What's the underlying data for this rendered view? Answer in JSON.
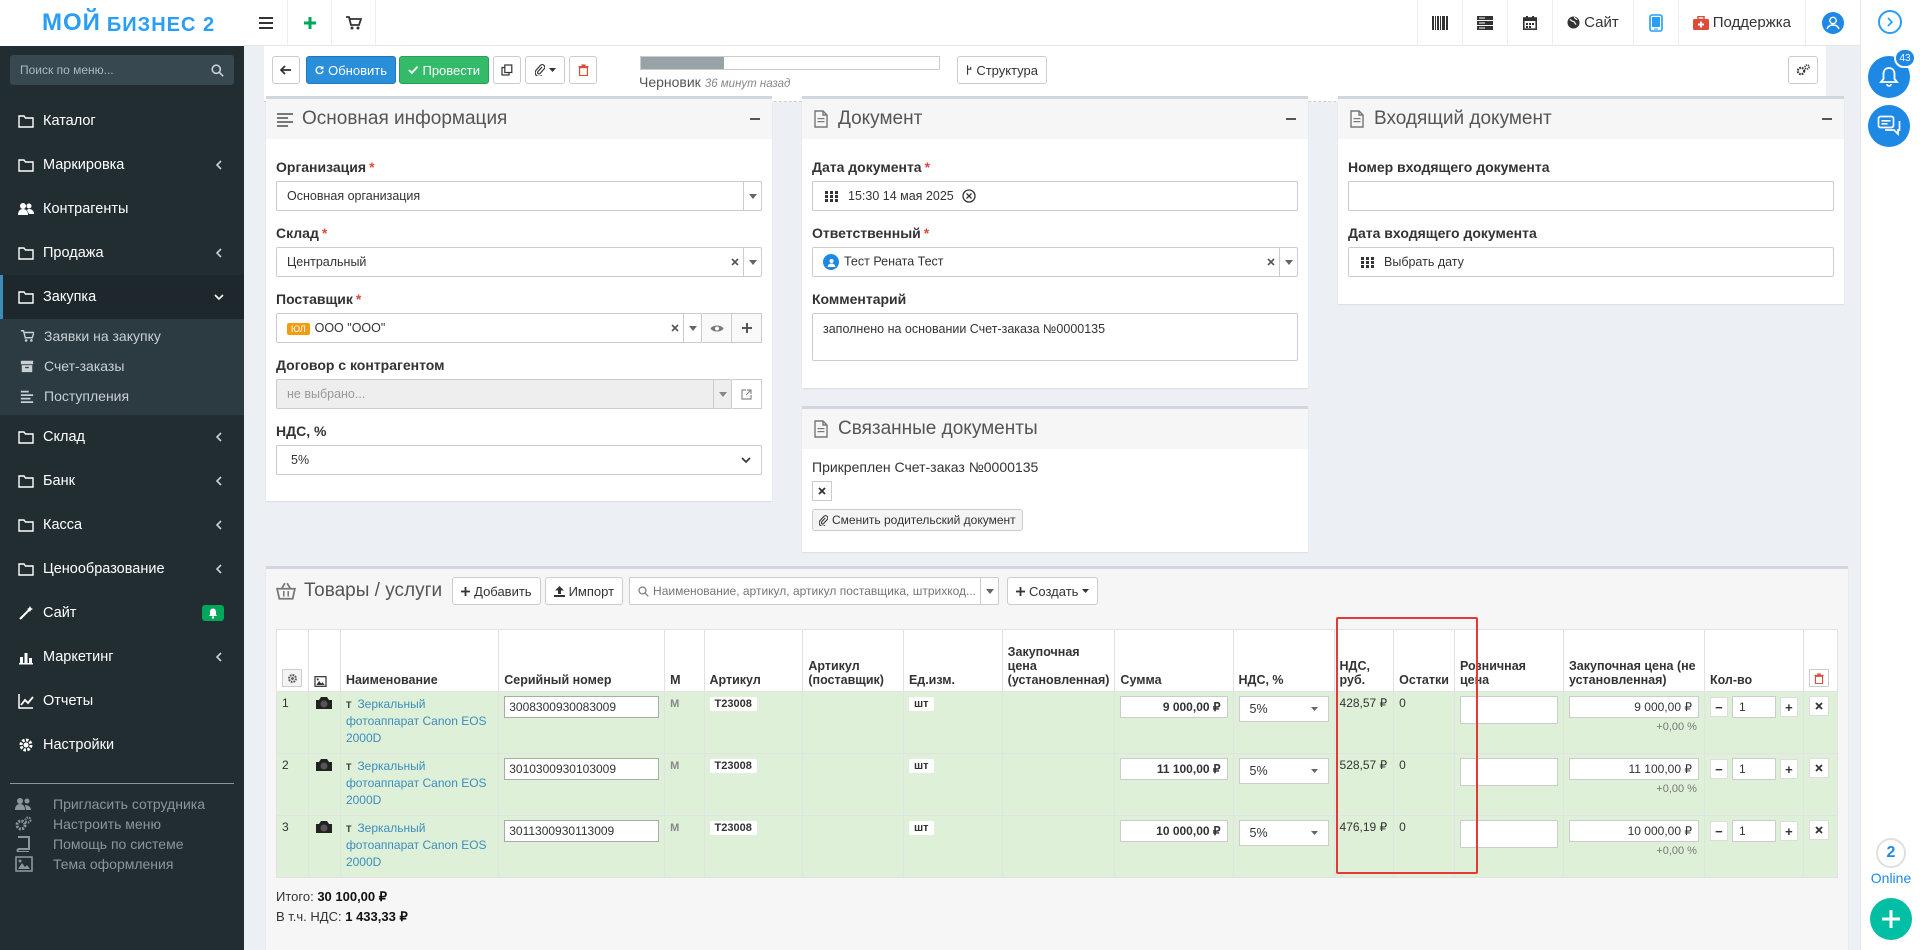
{
  "sidebar": {
    "logo_line1": "МОЙ",
    "logo_line2": "БИЗНЕС 2",
    "search_placeholder": "Поиск по меню...",
    "items": [
      {
        "label": "Каталог"
      },
      {
        "label": "Маркировка"
      },
      {
        "label": "Контрагенты"
      },
      {
        "label": "Продажа"
      },
      {
        "label": "Закупка"
      },
      {
        "label": "Склад"
      },
      {
        "label": "Банк"
      },
      {
        "label": "Касса"
      },
      {
        "label": "Ценообразование"
      },
      {
        "label": "Сайт"
      },
      {
        "label": "Маркетинг"
      },
      {
        "label": "Отчеты"
      },
      {
        "label": "Настройки"
      }
    ],
    "subitems": [
      {
        "label": "Заявки на закупку"
      },
      {
        "label": "Счет-заказы"
      },
      {
        "label": "Поступления"
      }
    ],
    "bottom": [
      {
        "label": "Пригласить сотрудника"
      },
      {
        "label": "Настроить меню"
      },
      {
        "label": "Помощь по системе"
      },
      {
        "label": "Тема оформления"
      }
    ]
  },
  "topnav": {
    "site_label": "Сайт",
    "support_label": "Поддержка"
  },
  "rail": {
    "notif_count": "43",
    "online_count": "2",
    "online_label": "Online"
  },
  "toolbar": {
    "refresh_label": "Обновить",
    "post_label": "Провести",
    "structure_label": "Структура",
    "status_label": "Черновик",
    "status_time": "36 минут назад",
    "progress": 0.28
  },
  "basic": {
    "title": "Основная информация",
    "org_label": "Организация",
    "org_value": "Основная организация",
    "warehouse_label": "Склад",
    "warehouse_value": "Центральный",
    "supplier_label": "Поставщик",
    "supplier_tag": "ЮЛ",
    "supplier_value": "ООО \"ООО\"",
    "contract_label": "Договор с контрагентом",
    "contract_value": "не выбрано...",
    "vat_label": "НДС, %",
    "vat_value": "5%"
  },
  "document": {
    "title": "Документ",
    "date_label": "Дата документа",
    "date_value": "15:30 14 мая 2025",
    "resp_label": "Ответственный",
    "resp_value": "Тест Рената Тест",
    "comment_label": "Комментарий",
    "comment_value": "заполнено на основании Счет-заказа №0000135"
  },
  "incoming": {
    "title": "Входящий документ",
    "number_label": "Номер входящего документа",
    "number_value": "",
    "date_label": "Дата входящего документа",
    "date_value": "Выбрать дату"
  },
  "linked": {
    "title": "Связанные документы",
    "attached": "Прикреплен Счет-заказ №0000135",
    "change_label": "Сменить родительский документ"
  },
  "goods": {
    "title": "Товары / услуги",
    "add_label": "Добавить",
    "import_label": "Импорт",
    "search_placeholder": "Наименование, артикул, артикул поставщика, штрихкод...",
    "create_label": "Создать",
    "columns": {
      "name": "Наименование",
      "serial": "Серийный номер",
      "m": "М",
      "article": "Артикул",
      "sup_article": "Артикул (поставщик)",
      "unit": "Ед.изм.",
      "price_set": "Закупочная цена (установленная)",
      "sum": "Сумма",
      "vat_pct": "НДС, %",
      "vat_rub": "НДС, руб.",
      "stock": "Остатки",
      "retail": "Розничная цена",
      "price_unset": "Закупочная цена (не установленная)",
      "qty": "Кол-во"
    },
    "rows": [
      {
        "n": "1",
        "type": "Т",
        "name": "Зеркальный фотоаппарат Canon EOS 2000D",
        "serial": "3008300930083009",
        "m": "М",
        "article": "Т23008",
        "unit": "шт",
        "sum": "9 000,00 ₽",
        "vat": "5%",
        "vat_rub": "428,57 ₽",
        "stock": "0",
        "price": "9 000,00 ₽",
        "pct": "+0,00 %",
        "qty": "1"
      },
      {
        "n": "2",
        "type": "Т",
        "name": "Зеркальный фотоаппарат Canon EOS 2000D",
        "serial": "3010300930103009",
        "m": "М",
        "article": "Т23008",
        "unit": "шт",
        "sum": "11 100,00 ₽",
        "vat": "5%",
        "vat_rub": "528,57 ₽",
        "stock": "0",
        "price": "11 100,00 ₽",
        "pct": "+0,00 %",
        "qty": "1"
      },
      {
        "n": "3",
        "type": "Т",
        "name": "Зеркальный фотоаппарат Canon EOS 2000D",
        "serial": "3011300930113009",
        "m": "М",
        "article": "Т23008",
        "unit": "шт",
        "sum": "10 000,00 ₽",
        "vat": "5%",
        "vat_rub": "476,19 ₽",
        "stock": "0",
        "price": "10 000,00 ₽",
        "pct": "+0,00 %",
        "qty": "1"
      }
    ],
    "total_label": "Итого:",
    "total_value": "30 100,00 ₽",
    "vat_total_label": "В т.ч. НДС:",
    "vat_total_value": "1 433,33 ₽"
  },
  "colors": {
    "accent": "#2a8fdb",
    "success": "#33bb6a",
    "row_bg": "#dff0d8",
    "highlight": "#e53935",
    "sidebar_bg": "#222d32"
  }
}
